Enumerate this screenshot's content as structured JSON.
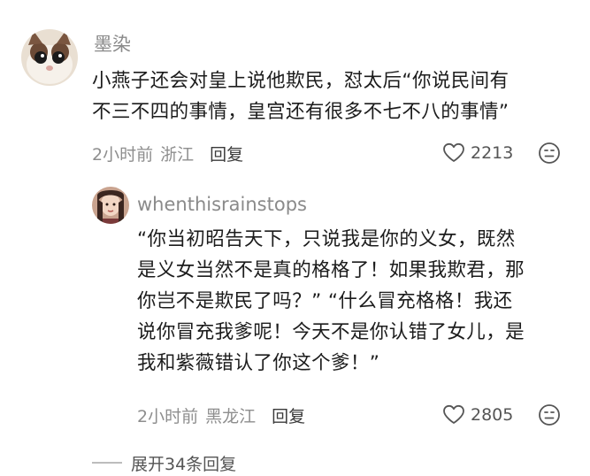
{
  "comments": [
    {
      "username": "墨染",
      "content_lines": [
        "小燕子还会对皇上说他欺民，怼太后“你说民间有",
        "不三不四的事情，皇宫还有很多不七不八的事情”"
      ],
      "time": "2小时前",
      "location": "浙江",
      "reply_label": "回复",
      "likes": "2213",
      "avatar_icon": "cat-avatar",
      "like_icon": "heart-outline-icon",
      "dislike_icon": "frown-face-icon"
    },
    {
      "username": "whenthisrainstops",
      "content_lines": [
        "“你当初昭告天下，只说我是你的义女，既然",
        "是义女当然不是真的格格了！如果我欺君，那",
        "你岂不是欺民了吗？” “什么冒充格格！我还",
        "说你冒充我爹呢！今天不是你认错了女儿，是",
        "我和紫薇错认了你这个爹！”"
      ],
      "time": "2小时前",
      "location": "黑龙江",
      "reply_label": "回复",
      "likes": "2805",
      "avatar_icon": "person-avatar",
      "like_icon": "heart-outline-icon",
      "dislike_icon": "frown-face-icon"
    }
  ],
  "expand_replies": {
    "label": "展开34条回复"
  },
  "colors": {
    "username": "#8a8a8a",
    "text": "#1c1c1c",
    "meta": "#8e8e8e",
    "icon": "#555555"
  }
}
